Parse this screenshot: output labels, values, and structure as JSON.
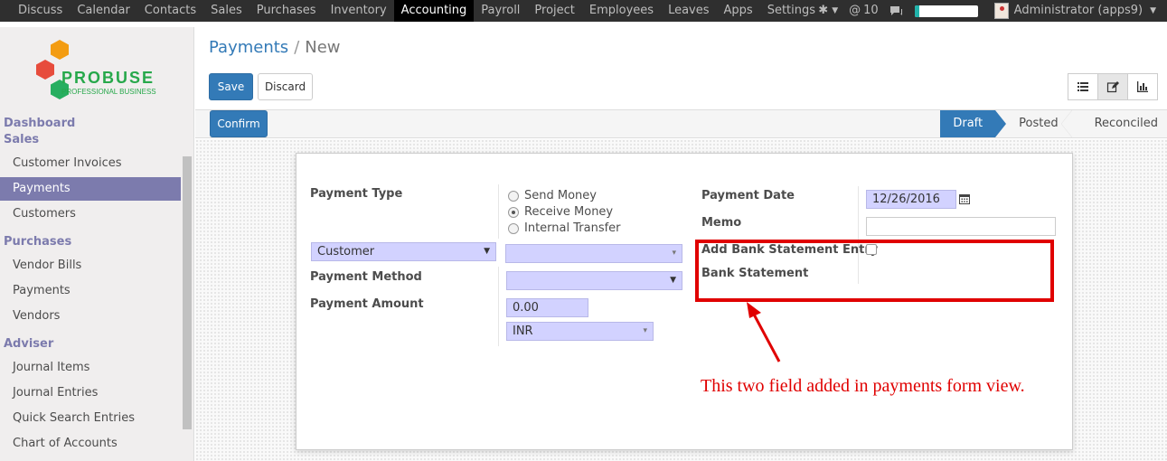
{
  "topbar": {
    "menu": [
      "Discuss",
      "Calendar",
      "Contacts",
      "Sales",
      "Purchases",
      "Inventory",
      "Accounting",
      "Payroll",
      "Project",
      "Employees",
      "Leaves",
      "Apps",
      "Settings"
    ],
    "active_menu": "Accounting",
    "mention_count": "10",
    "mention_symbol": "@",
    "progress_percent": 8,
    "user_label": "Administrator (apps9)"
  },
  "logo": {
    "brand": "PROBUSE",
    "tagline": "PROFESSIONAL BUSINESS"
  },
  "sidebar": {
    "sections": [
      "Dashboard",
      "Sales",
      "Purchases",
      "Adviser"
    ],
    "sales_items": [
      "Customer Invoices",
      "Payments",
      "Customers"
    ],
    "purchases_items": [
      "Vendor Bills",
      "Payments",
      "Vendors"
    ],
    "adviser_items": [
      "Journal Items",
      "Journal Entries",
      "Quick Search Entries",
      "Chart of Accounts"
    ],
    "active_item": "Payments"
  },
  "breadcrumb": {
    "parent": "Payments",
    "separator": "/",
    "current": "New"
  },
  "toolbar": {
    "save_label": "Save",
    "discard_label": "Discard"
  },
  "statusbar": {
    "confirm_label": "Confirm",
    "steps": [
      "Draft",
      "Posted",
      "Reconciled"
    ],
    "current_step": "Draft"
  },
  "form": {
    "payment_type_label": "Payment Type",
    "payment_type_options": [
      "Send Money",
      "Receive Money",
      "Internal Transfer"
    ],
    "payment_type_selected": "Receive Money",
    "partner_type_value": "Customer",
    "partner_value": "",
    "payment_method_label": "Payment Method",
    "payment_method_value": "",
    "payment_amount_label": "Payment Amount",
    "amount_value": "0.00",
    "currency_value": "INR",
    "payment_date_label": "Payment Date",
    "payment_date_value": "12/26/2016",
    "memo_label": "Memo",
    "memo_value": "",
    "bank_entry_label": "Add Bank Statement Entry",
    "bank_entry_checked": false,
    "bank_statement_label": "Bank Statement"
  },
  "annotation": {
    "text": "This two field added in payments form view.",
    "color": "#e00000"
  },
  "colors": {
    "brand_primary": "#337ab7",
    "sidebar_accent": "#7c7bad",
    "required_field": "#d2d2ff",
    "topbar": "#2f2f2f"
  }
}
